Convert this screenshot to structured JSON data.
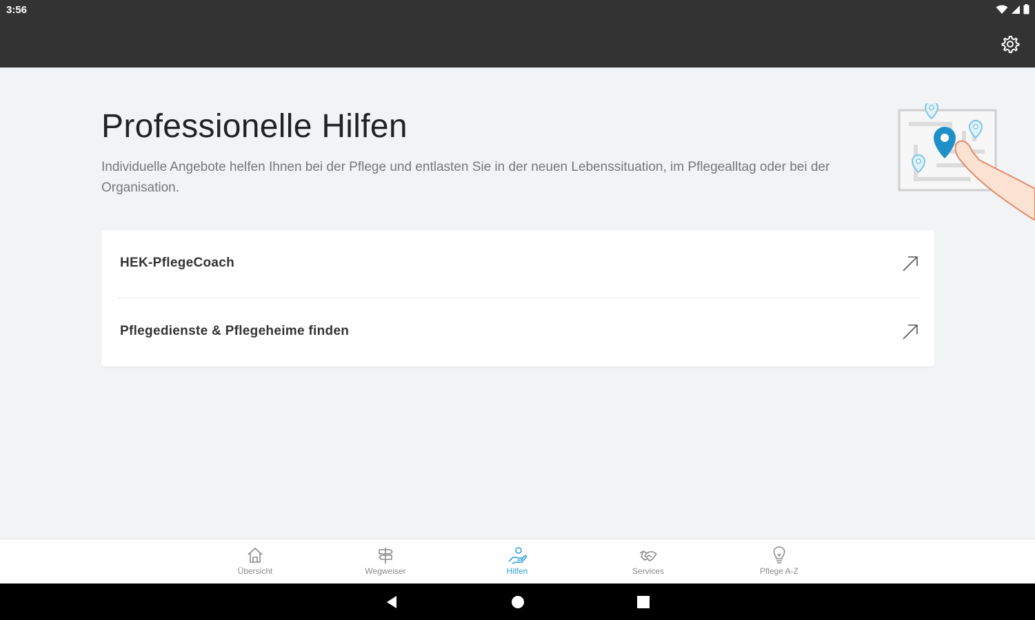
{
  "status": {
    "time": "3:56"
  },
  "header": {
    "settings_icon": "gear-icon"
  },
  "page": {
    "title": "Professionelle Hilfen",
    "description": "Individuelle Angebote helfen Ihnen bei der Pflege und entlasten Sie in der neuen Lebenssituation, im Pflegealltag oder bei der Organisation."
  },
  "links": [
    {
      "label": "HEK-PflegeCoach",
      "icon": "external-arrow-icon"
    },
    {
      "label": "Pflegedienste & Pflegeheime finden",
      "icon": "external-arrow-icon"
    }
  ],
  "nav": {
    "items": [
      {
        "label": "Übersicht",
        "icon": "home-icon"
      },
      {
        "label": "Wegweiser",
        "icon": "signpost-icon"
      },
      {
        "label": "Hilfen",
        "icon": "helping-hand-icon",
        "active": true
      },
      {
        "label": "Services",
        "icon": "handshake-icon"
      },
      {
        "label": "Pflege A-Z",
        "icon": "lightbulb-icon"
      }
    ]
  },
  "colors": {
    "accent": "#2a9fd6",
    "statusbar": "#333333",
    "background": "#f2f3f5",
    "inactive": "#8a8a8a"
  }
}
